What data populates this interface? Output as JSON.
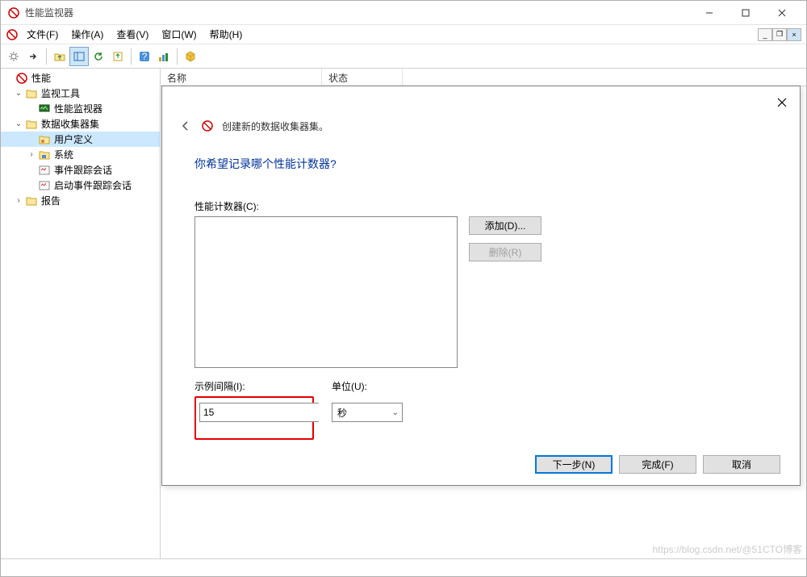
{
  "window": {
    "title": "性能监视器"
  },
  "menu": {
    "file": "文件(F)",
    "action": "操作(A)",
    "view": "查看(V)",
    "window": "窗口(W)",
    "help": "帮助(H)"
  },
  "tree": {
    "root": "性能",
    "monitoring_tools": "监视工具",
    "performance_monitor": "性能监视器",
    "data_collector_sets": "数据收集器集",
    "user_defined": "用户定义",
    "system": "系统",
    "event_trace_sessions": "事件跟踪会话",
    "startup_event_trace": "启动事件跟踪会话",
    "reports": "报告"
  },
  "list": {
    "col_name": "名称",
    "col_status": "状态"
  },
  "dialog": {
    "wizard_title": "创建新的数据收集器集。",
    "question": "你希望记录哪个性能计数器?",
    "counters_label": "性能计数器(C):",
    "add_btn": "添加(D)...",
    "remove_btn": "删除(R)",
    "interval_label": "示例间隔(I):",
    "interval_value": "15",
    "unit_label": "单位(U):",
    "unit_value": "秒",
    "next_btn": "下一步(N)",
    "finish_btn": "完成(F)",
    "cancel_btn": "取消"
  },
  "watermark": "https://blog.csdn.net/@51CTO博客"
}
